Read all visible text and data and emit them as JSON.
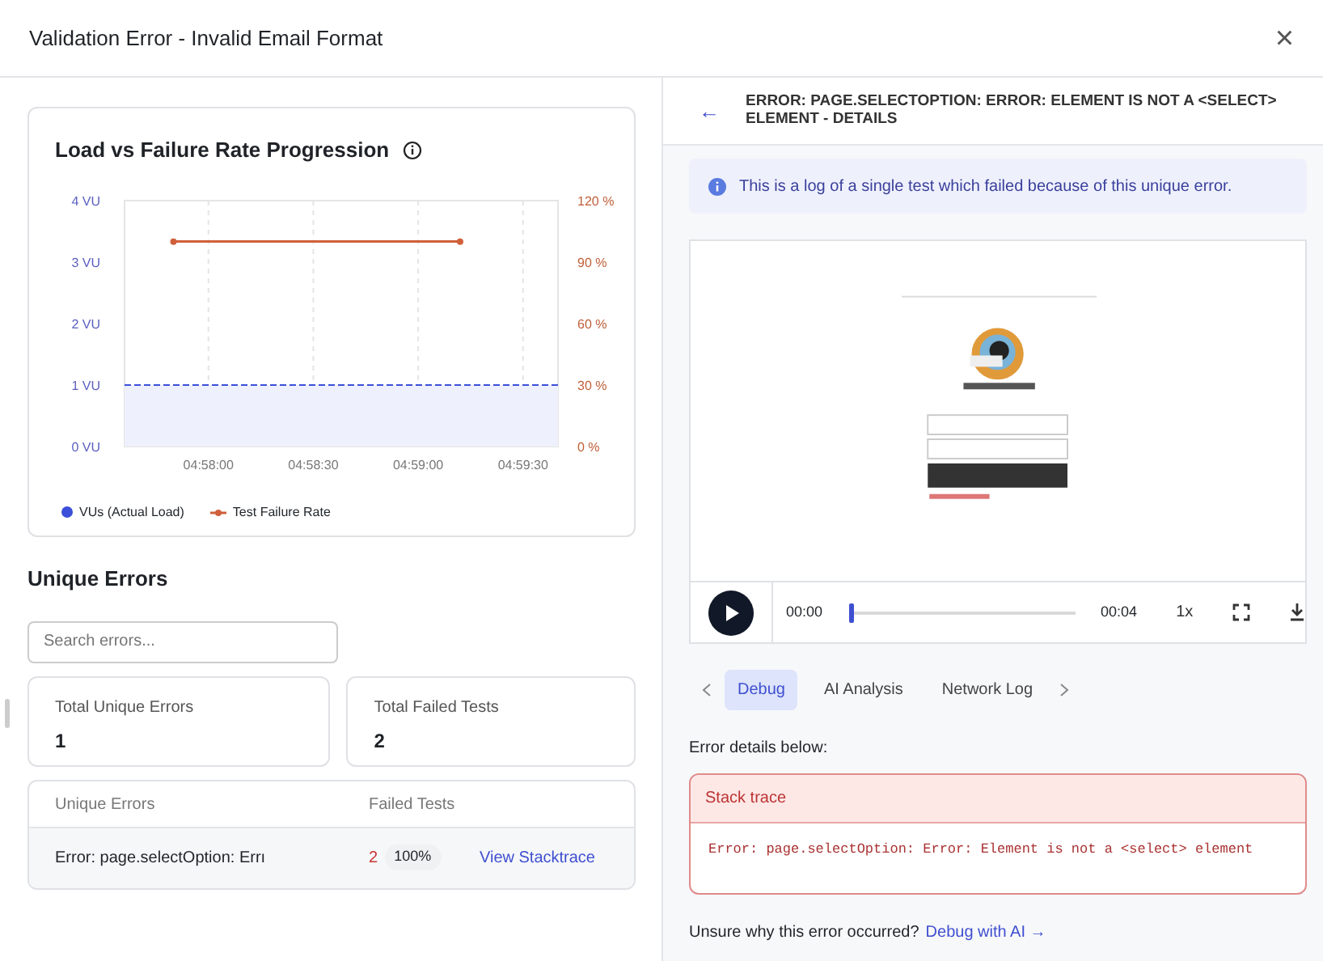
{
  "window": {
    "title": "Validation Error - Invalid Email Format",
    "close": "×"
  },
  "chart_card": {
    "title": "Load vs Failure Rate Progression",
    "chart_data": {
      "type": "line",
      "grid": true,
      "legend": "bottom",
      "x": [
        17856,
        17870,
        17952,
        17980
      ],
      "xlim": [
        17856,
        17980
      ],
      "xticks": [
        {
          "value": 17880,
          "label": "04:58:00"
        },
        {
          "value": 17910,
          "label": "04:58:30"
        },
        {
          "value": 17940,
          "label": "04:59:00"
        },
        {
          "value": 17970,
          "label": "04:59:30"
        }
      ],
      "ylim": [
        0,
        4
      ],
      "yticks": [
        {
          "value": 0,
          "label": "0 VU"
        },
        {
          "value": 1,
          "label": "1 VU"
        },
        {
          "value": 2,
          "label": "2 VU"
        },
        {
          "value": 3,
          "label": "3 VU"
        },
        {
          "value": 4,
          "label": "4 VU"
        }
      ],
      "y2lim": [
        0,
        120
      ],
      "y2ticks": [
        {
          "value": 0,
          "label": "0 %"
        },
        {
          "value": 30,
          "label": "30 %"
        },
        {
          "value": 60,
          "label": "60 %"
        },
        {
          "value": 90,
          "label": "90 %"
        },
        {
          "value": 120,
          "label": "120 %"
        }
      ],
      "series": [
        {
          "name": "VUs (Actual Load)",
          "color": "#3b4fd8",
          "values": [
            1,
            1,
            1,
            1
          ],
          "line_style": "dashed"
        },
        {
          "name": "Test Failure Rate",
          "color": "#d0603a",
          "values": [
            null,
            100,
            100,
            null
          ],
          "axis": "y2",
          "marker": "circle"
        }
      ]
    }
  },
  "unique_errors": {
    "heading": "Unique Errors",
    "search": {
      "placeholder": "Search errors..."
    },
    "stats": [
      {
        "label": "Total Unique Errors",
        "value": "1"
      },
      {
        "label": "Total Failed Tests",
        "value": "2"
      }
    ],
    "table": {
      "columns": [
        "Unique Errors",
        "Failed Tests"
      ],
      "rows": [
        {
          "error": "Error: page.selectOption: Errı",
          "count": "2",
          "percent": "100%",
          "link": "View Stacktrace"
        }
      ]
    }
  },
  "detail": {
    "back": "←",
    "title": "ERROR: PAGE.SELECTOPTION: ERROR: ELEMENT IS NOT A <SELECT> ELEMENT - DETAILS",
    "info": "This is a log of a single test which failed because of this unique error.",
    "player": {
      "current": "00:00",
      "total": "00:04",
      "level": 0.0,
      "speed": "1x"
    },
    "tabs": [
      {
        "label": "Debug",
        "selected": true
      },
      {
        "label": "AI Analysis",
        "selected": false
      },
      {
        "label": "Network Log",
        "selected": false
      }
    ],
    "details_label": "Error details below:",
    "stack_title": "Stack trace",
    "stack_text": "Error: page.selectOption: Error: Element is not a <select> element",
    "help_text": "Unsure why this error occurred?",
    "help_link": "Debug with AI →"
  }
}
